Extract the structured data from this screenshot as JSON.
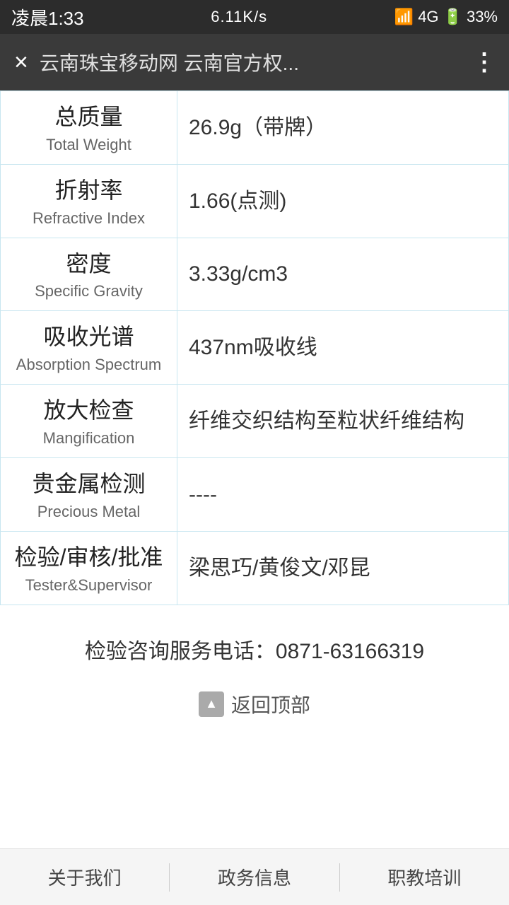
{
  "statusBar": {
    "time": "凌晨1:33",
    "network": "6.11K/s",
    "signal": "4G",
    "battery": "33%"
  },
  "browserBar": {
    "title": "云南珠宝移动网 云南官方权...",
    "closeIcon": "×",
    "moreIcon": "⋮"
  },
  "tableRows": [
    {
      "labelCn": "总质量",
      "labelEn": "Total Weight",
      "value": "26.9g（带牌）"
    },
    {
      "labelCn": "折射率",
      "labelEn": "Refractive Index",
      "value": "1.66(点测)"
    },
    {
      "labelCn": "密度",
      "labelEn": "Specific Gravity",
      "value": "3.33g/cm3"
    },
    {
      "labelCn": "吸收光谱",
      "labelEn": "Absorption Spectrum",
      "value": "437nm吸收线"
    },
    {
      "labelCn": "放大检查",
      "labelEn": "Mangification",
      "value": "纤维交织结构至粒状纤维结构"
    },
    {
      "labelCn": "贵金属检测",
      "labelEn": "Precious Metal",
      "value": "----"
    },
    {
      "labelCn": "检验/审核/批准",
      "labelEn": "Tester&Supervisor",
      "value": "梁思巧/黄俊文/邓昆"
    }
  ],
  "footer": {
    "phone": "检验咨询服务电话：0871-63166319",
    "backToTop": "返回顶部"
  },
  "bottomNav": [
    {
      "label": "关于我们"
    },
    {
      "label": "政务信息"
    },
    {
      "label": "职教培训"
    }
  ]
}
